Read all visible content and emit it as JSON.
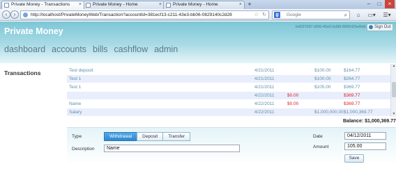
{
  "browser": {
    "tabs": [
      {
        "title": "Private Money - Transactions",
        "active": true
      },
      {
        "title": "Private Money - Home",
        "active": false
      },
      {
        "title": "Private Money - Home",
        "active": false
      }
    ],
    "url": "http://localhost/PrivateMoneyWeb/Transaction?accountId=381ecf13-c211-43e3-bb06-0829140c2d28",
    "search_placeholder": "Google"
  },
  "app": {
    "brand": "Private Money",
    "account_id": "b4037097-d5f9-45e0-bd98-896542fa4fdd",
    "signout_label": "Sign Out",
    "menu": [
      "dashboard",
      "accounts",
      "bills",
      "cashflow",
      "admin"
    ]
  },
  "page": {
    "section_title": "Transactions",
    "balance_label": "Balance: $1,000,369.77"
  },
  "transactions": [
    {
      "name": "Test deposit",
      "date": "4/21/2011",
      "withdrawal": "",
      "deposit": "$100.00",
      "balance": "$164.77"
    },
    {
      "name": "Test 1",
      "date": "4/21/2011",
      "withdrawal": "",
      "deposit": "$100.00",
      "balance": "$264.77"
    },
    {
      "name": "Test 1",
      "date": "4/21/2011",
      "withdrawal": "",
      "deposit": "$105.00",
      "balance": "$369.77"
    },
    {
      "name": "",
      "date": "4/22/2011",
      "withdrawal": "$0.00",
      "deposit": "",
      "balance": "$369.77"
    },
    {
      "name": "Name",
      "date": "4/22/2011",
      "withdrawal": "$0.00",
      "deposit": "",
      "balance": "$369.77"
    },
    {
      "name": "Salary",
      "date": "4/22/2011",
      "withdrawal": "",
      "deposit": "$1,000,000.00",
      "balance": "$1,000,369.77"
    }
  ],
  "form": {
    "type_label": "Type",
    "type_options": [
      "Withdrawal",
      "Deposit",
      "Transfer"
    ],
    "selected_type": "Withdrawal",
    "description_label": "Description",
    "description_value": "Name",
    "date_label": "Date",
    "date_value": "04/12/2011",
    "amount_label": "Amount",
    "amount_value": "105.00",
    "save_label": "Save"
  },
  "colors": {
    "header_top": "#7cc6d6",
    "header_bottom": "#e6f5f8",
    "row_text": "#5f8fa8",
    "negative": "#e02020",
    "selected_segment": "#2d87cf",
    "alt_row": "#e8eefc"
  }
}
